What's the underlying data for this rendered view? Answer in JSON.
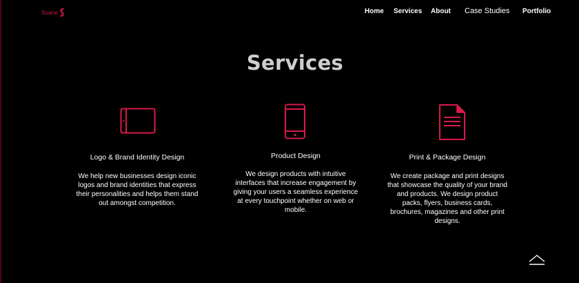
{
  "brand": {
    "logo_text": "Suane",
    "accent_color": "#d81a4a"
  },
  "nav": {
    "items": [
      "Home",
      "Services",
      "About",
      "Case Studies",
      "Portfolio"
    ]
  },
  "section": {
    "title": "Services"
  },
  "services": [
    {
      "icon": "tablet-icon",
      "title": "Logo & Brand Identity Design",
      "description": "We help new businesses design iconic logos and brand identities that express their personalities and helps them stand out amongst competition."
    },
    {
      "icon": "smartphone-icon",
      "title": "Product Design",
      "description": "We design products with intuitive interfaces that increase engagement by giving your users a seamless experience at every touchpoint whether on web or mobile."
    },
    {
      "icon": "document-icon",
      "title": "Print & Package Design",
      "description": "We create package and print designs that showcase the quality of your brand and products. We design product packs, flyers, business cards, brochures, magazines and other print designs."
    }
  ],
  "scroll_top": {
    "icon": "chevron-up-icon"
  }
}
